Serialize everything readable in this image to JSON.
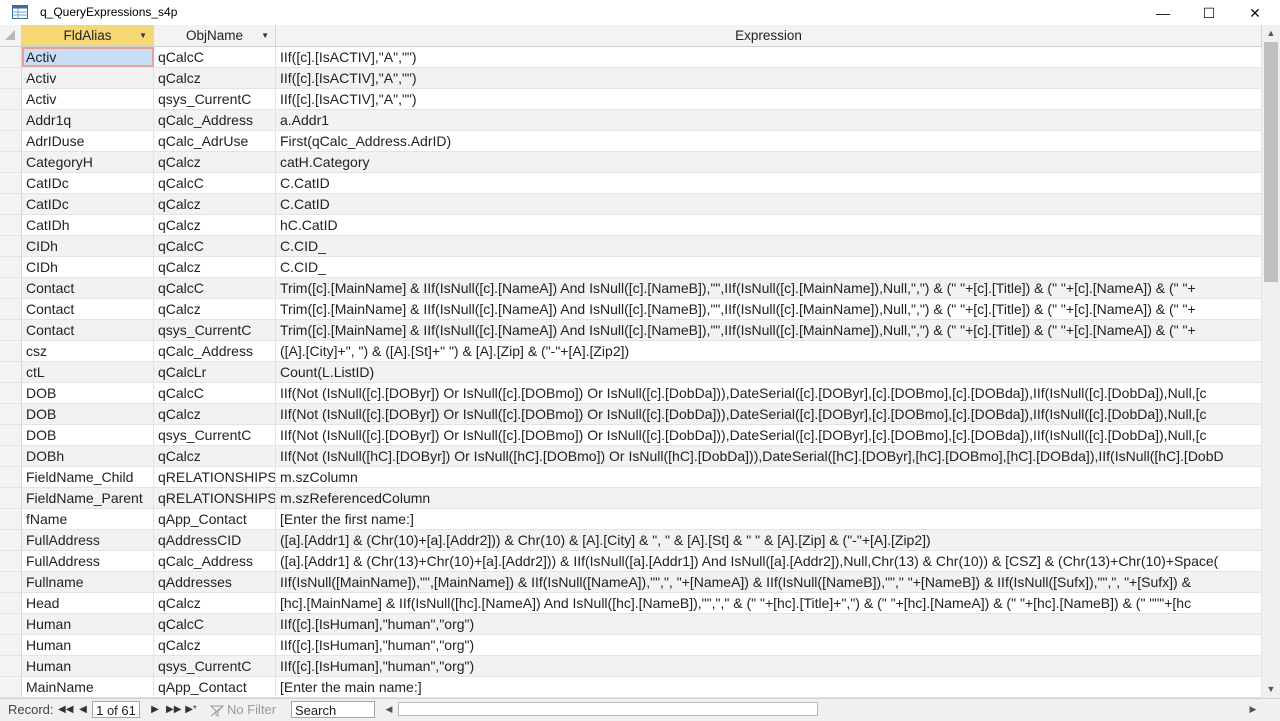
{
  "window": {
    "title": "q_QueryExpressions_s4p",
    "minimize": "—",
    "maximize": "☐",
    "close": "✕"
  },
  "columns": {
    "fldalias": "FldAlias",
    "objname": "ObjName",
    "expression": "Expression"
  },
  "rows": [
    {
      "fldalias": "Activ",
      "objname": "qCalcC",
      "expression": "IIf([c].[IsACTIV],\"A\",\"\")"
    },
    {
      "fldalias": "Activ",
      "objname": "qCalcz",
      "expression": "IIf([c].[IsACTIV],\"A\",\"\")"
    },
    {
      "fldalias": "Activ",
      "objname": "qsys_CurrentC",
      "expression": "IIf([c].[IsACTIV],\"A\",\"\")"
    },
    {
      "fldalias": "Addr1q",
      "objname": "qCalc_Address",
      "expression": "a.Addr1"
    },
    {
      "fldalias": "AdrIDuse",
      "objname": "qCalc_AdrUse",
      "expression": "First(qCalc_Address.AdrID)"
    },
    {
      "fldalias": "CategoryH",
      "objname": "qCalcz",
      "expression": "catH.Category"
    },
    {
      "fldalias": "CatIDc",
      "objname": "qCalcC",
      "expression": "C.CatID"
    },
    {
      "fldalias": "CatIDc",
      "objname": "qCalcz",
      "expression": "C.CatID"
    },
    {
      "fldalias": "CatIDh",
      "objname": "qCalcz",
      "expression": "hC.CatID"
    },
    {
      "fldalias": "CIDh",
      "objname": "qCalcC",
      "expression": "C.CID_"
    },
    {
      "fldalias": "CIDh",
      "objname": "qCalcz",
      "expression": "C.CID_"
    },
    {
      "fldalias": "Contact",
      "objname": "qCalcC",
      "expression": "Trim([c].[MainName] & IIf(IsNull([c].[NameA]) And IsNull([c].[NameB]),\"\",IIf(IsNull([c].[MainName]),Null,\",\") & (\" \"+[c].[Title]) & (\" \"+[c].[NameA]) & (\" \"+"
    },
    {
      "fldalias": "Contact",
      "objname": "qCalcz",
      "expression": "Trim([c].[MainName] & IIf(IsNull([c].[NameA]) And IsNull([c].[NameB]),\"\",IIf(IsNull([c].[MainName]),Null,\",\") & (\" \"+[c].[Title]) & (\" \"+[c].[NameA]) & (\" \"+"
    },
    {
      "fldalias": "Contact",
      "objname": "qsys_CurrentC",
      "expression": "Trim([c].[MainName] & IIf(IsNull([c].[NameA]) And IsNull([c].[NameB]),\"\",IIf(IsNull([c].[MainName]),Null,\",\") & (\" \"+[c].[Title]) & (\" \"+[c].[NameA]) & (\" \"+"
    },
    {
      "fldalias": "csz",
      "objname": "qCalc_Address",
      "expression": "([A].[City]+\", \") & ([A].[St]+\"  \") & [A].[Zip] & (\"-\"+[A].[Zip2])"
    },
    {
      "fldalias": "ctL",
      "objname": "qCalcLr",
      "expression": "Count(L.ListID)"
    },
    {
      "fldalias": "DOB",
      "objname": "qCalcC",
      "expression": "IIf(Not (IsNull([c].[DOByr]) Or IsNull([c].[DOBmo]) Or IsNull([c].[DobDa])),DateSerial([c].[DOByr],[c].[DOBmo],[c].[DOBda]),IIf(IsNull([c].[DobDa]),Null,[c"
    },
    {
      "fldalias": "DOB",
      "objname": "qCalcz",
      "expression": "IIf(Not (IsNull([c].[DOByr]) Or IsNull([c].[DOBmo]) Or IsNull([c].[DobDa])),DateSerial([c].[DOByr],[c].[DOBmo],[c].[DOBda]),IIf(IsNull([c].[DobDa]),Null,[c"
    },
    {
      "fldalias": "DOB",
      "objname": "qsys_CurrentC",
      "expression": "IIf(Not (IsNull([c].[DOByr]) Or IsNull([c].[DOBmo]) Or IsNull([c].[DobDa])),DateSerial([c].[DOByr],[c].[DOBmo],[c].[DOBda]),IIf(IsNull([c].[DobDa]),Null,[c"
    },
    {
      "fldalias": "DOBh",
      "objname": "qCalcz",
      "expression": "IIf(Not (IsNull([hC].[DOByr]) Or IsNull([hC].[DOBmo]) Or IsNull([hC].[DobDa])),DateSerial([hC].[DOByr],[hC].[DOBmo],[hC].[DOBda]),IIf(IsNull([hC].[DobD"
    },
    {
      "fldalias": "FieldName_Child",
      "objname": "qRELATIONSHIPS",
      "expression": "m.szColumn"
    },
    {
      "fldalias": "FieldName_Parent",
      "objname": "qRELATIONSHIPS",
      "expression": "m.szReferencedColumn"
    },
    {
      "fldalias": "fName",
      "objname": "qApp_Contact",
      "expression": "[Enter the first name:]"
    },
    {
      "fldalias": "FullAddress",
      "objname": "qAddressCID",
      "expression": "([a].[Addr1] & (Chr(10)+[a].[Addr2])) & Chr(10) & [A].[City] & \", \" & [A].[St] & \"  \" & [A].[Zip] & (\"-\"+[A].[Zip2])"
    },
    {
      "fldalias": "FullAddress",
      "objname": "qCalc_Address",
      "expression": "([a].[Addr1] & (Chr(13)+Chr(10)+[a].[Addr2])) & IIf(IsNull([a].[Addr1]) And IsNull([a].[Addr2]),Null,Chr(13) & Chr(10)) & [CSZ] & (Chr(13)+Chr(10)+Space("
    },
    {
      "fldalias": "Fullname",
      "objname": "qAddresses",
      "expression": "IIf(IsNull([MainName]),\"\",[MainName]) & IIf(IsNull([NameA]),\"\",\", \"+[NameA]) & IIf(IsNull([NameB]),\"\",\" \"+[NameB]) & IIf(IsNull([Sufx]),\"\",\", \"+[Sufx]) & "
    },
    {
      "fldalias": "Head",
      "objname": "qCalcz",
      "expression": "[hc].[MainName] & IIf(IsNull([hc].[NameA]) And IsNull([hc].[NameB]),\"\",\",\" & (\" \"+[hc].[Title]+\",\") & (\" \"+[hc].[NameA]) & (\" \"+[hc].[NameB]) & (\" \"\"\"+[hc"
    },
    {
      "fldalias": "Human",
      "objname": "qCalcC",
      "expression": "IIf([c].[IsHuman],\"human\",\"org\")"
    },
    {
      "fldalias": "Human",
      "objname": "qCalcz",
      "expression": "IIf([c].[IsHuman],\"human\",\"org\")"
    },
    {
      "fldalias": "Human",
      "objname": "qsys_CurrentC",
      "expression": "IIf([c].[IsHuman],\"human\",\"org\")"
    },
    {
      "fldalias": "MainName",
      "objname": "qApp_Contact",
      "expression": "[Enter the main name:]"
    }
  ],
  "navigation": {
    "record_label": "Record:",
    "first": "◀◀",
    "prev": "◀",
    "current": "1 of 61",
    "next": "▶",
    "last": "▶▶",
    "new": "▶*",
    "filter_label": "No Filter",
    "search_placeholder": "Search"
  },
  "colors": {
    "sorted_header": "#f6d776",
    "active_cell_border": "#e8a09a",
    "active_cell_fill": "#c9dff5"
  }
}
